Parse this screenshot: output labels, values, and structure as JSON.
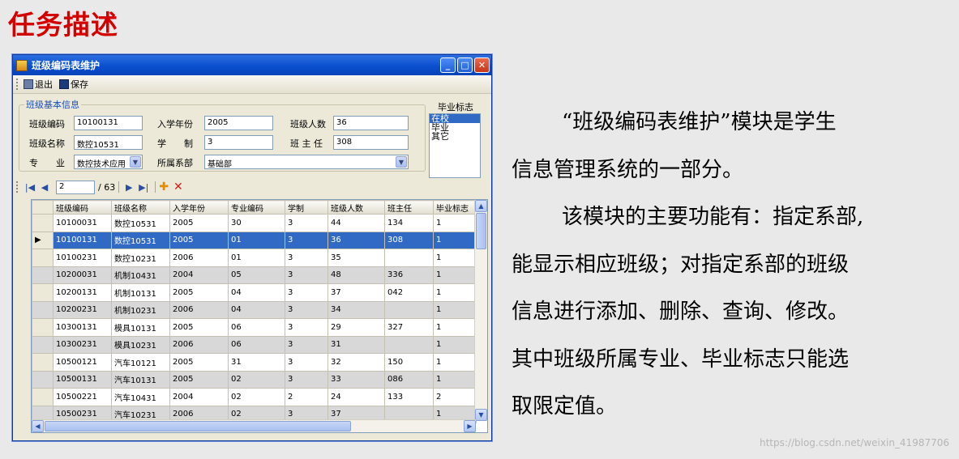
{
  "slide": {
    "title": "任务描述",
    "description": [
      "“班级编码表维护”模块是学生",
      "信息管理系统的一部分。",
      "该模块的主要功能有：指定系部,",
      "能显示相应班级；对指定系部的班级",
      "信息进行添加、删除、查询、修改。",
      "其中班级所属专业、毕业标志只能选",
      "取限定值。"
    ],
    "watermark": "https://blog.csdn.net/weixin_41987706"
  },
  "window": {
    "title": "班级编码表维护",
    "toolbar": {
      "exit_label": "退出",
      "save_label": "保存"
    },
    "group_title": "班级基本信息",
    "form": {
      "class_code_label": "班级编码",
      "class_code_value": "10100131",
      "enroll_year_label": "入学年份",
      "enroll_year_value": "2005",
      "class_size_label": "班级人数",
      "class_size_value": "36",
      "class_name_label": "班级名称",
      "class_name_value": "数控10531",
      "duration_label": "学　　制",
      "duration_value": "3",
      "advisor_label": "班 主 任",
      "advisor_value": "308",
      "major_label": "专　　业",
      "major_value": "数控技术应用",
      "dept_label": "所属系部",
      "dept_value": "基础部"
    },
    "grad_flag": {
      "label": "毕业标志",
      "options": [
        "在校",
        "毕业",
        "其它"
      ],
      "selected": "在校"
    },
    "navigator": {
      "position": "2",
      "total": "/ 63"
    },
    "grid": {
      "columns": [
        "班级编码",
        "班级名称",
        "入学年份",
        "专业编码",
        "学制",
        "班级人数",
        "班主任",
        "毕业标志"
      ],
      "rows": [
        [
          "10100031",
          "数控10531",
          "2005",
          "30",
          "3",
          "44",
          "134",
          "1"
        ],
        [
          "10100131",
          "数控10531",
          "2005",
          "01",
          "3",
          "36",
          "308",
          "1"
        ],
        [
          "10100231",
          "数控10231",
          "2006",
          "01",
          "3",
          "35",
          "",
          "1"
        ],
        [
          "10200031",
          "机制10431",
          "2004",
          "05",
          "3",
          "48",
          "336",
          "1"
        ],
        [
          "10200131",
          "机制10131",
          "2005",
          "04",
          "3",
          "37",
          "042",
          "1"
        ],
        [
          "10200231",
          "机制10231",
          "2006",
          "04",
          "3",
          "34",
          "",
          "1"
        ],
        [
          "10300131",
          "模具10131",
          "2005",
          "06",
          "3",
          "29",
          "327",
          "1"
        ],
        [
          "10300231",
          "模具10231",
          "2006",
          "06",
          "3",
          "31",
          "",
          "1"
        ],
        [
          "10500121",
          "汽车10121",
          "2005",
          "31",
          "3",
          "32",
          "150",
          "1"
        ],
        [
          "10500131",
          "汽车10131",
          "2005",
          "02",
          "3",
          "33",
          "086",
          "1"
        ],
        [
          "10500221",
          "汽车10431",
          "2004",
          "02",
          "2",
          "24",
          "133",
          "2"
        ],
        [
          "10500231",
          "汽车10231",
          "2006",
          "02",
          "3",
          "37",
          "",
          "1"
        ]
      ],
      "selected_row": 1
    }
  }
}
